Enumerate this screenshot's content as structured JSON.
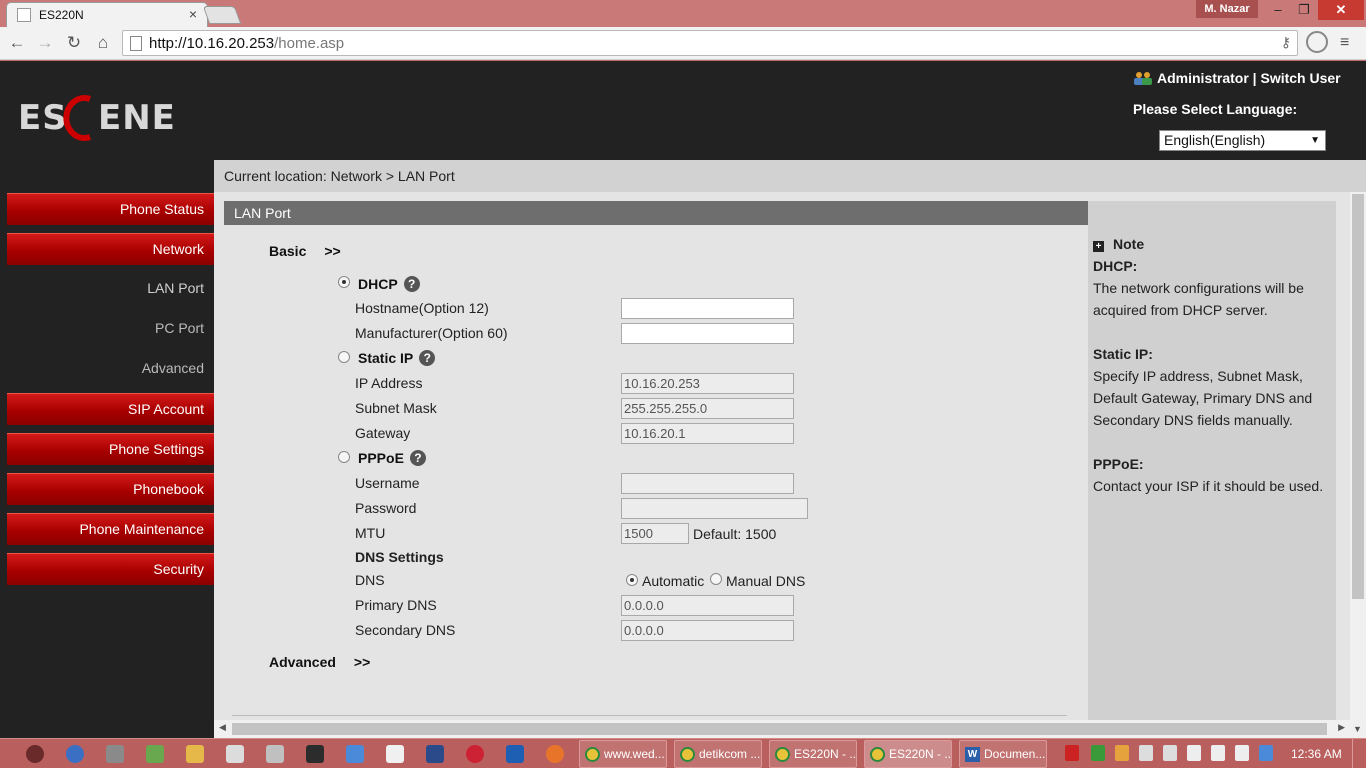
{
  "browser": {
    "tab_title": "ES220N",
    "tab_close": "×",
    "user_badge": "M. Nazar",
    "url_host": "http://10.16.20.253",
    "url_path": "/home.asp",
    "window_buttons": {
      "minimize": "–",
      "maximize": "❐",
      "close": "✕"
    },
    "nav_icons": {
      "back": "←",
      "forward": "→",
      "reload": "↻",
      "home": "⌂",
      "menu": "≡"
    }
  },
  "header": {
    "brand": "ESCENE",
    "admin": "Administrator | Switch User",
    "language_label": "Please Select Language:",
    "language_value": "English(English)"
  },
  "sidebar": {
    "items": [
      {
        "label": "Phone Status",
        "type": "main"
      },
      {
        "label": "Network",
        "type": "main"
      },
      {
        "label": "LAN Port",
        "type": "sub"
      },
      {
        "label": "PC Port",
        "type": "sub"
      },
      {
        "label": "Advanced",
        "type": "sub"
      },
      {
        "label": "SIP Account",
        "type": "main"
      },
      {
        "label": "Phone Settings",
        "type": "main"
      },
      {
        "label": "Phonebook",
        "type": "main"
      },
      {
        "label": "Phone Maintenance",
        "type": "main"
      },
      {
        "label": "Security",
        "type": "main"
      }
    ]
  },
  "main": {
    "breadcrumb": "Current location: Network > LAN Port",
    "panel_title": "LAN Port",
    "basic_label": "Basic",
    "basic_arrows": ">>",
    "advanced_label": "Advanced",
    "advanced_arrows": ">>",
    "dhcp": {
      "label": "DHCP",
      "selected": true,
      "hostname_label": "Hostname(Option 12)",
      "hostname_value": "",
      "manufacturer_label": "Manufacturer(Option 60)",
      "manufacturer_value": ""
    },
    "static_ip": {
      "label": "Static IP",
      "selected": false,
      "ip_label": "IP Address",
      "ip_value": "10.16.20.253",
      "mask_label": "Subnet Mask",
      "mask_value": "255.255.255.0",
      "gateway_label": "Gateway",
      "gateway_value": "10.16.20.1"
    },
    "pppoe": {
      "label": "PPPoE",
      "selected": false,
      "username_label": "Username",
      "username_value": "",
      "password_label": "Password",
      "password_value": "",
      "mtu_label": "MTU",
      "mtu_value": "1500",
      "mtu_default": "Default: 1500"
    },
    "dns": {
      "section_label": "DNS Settings",
      "dns_label": "DNS",
      "automatic": "Automatic",
      "manual": "Manual DNS",
      "mode": "Automatic",
      "primary_label": "Primary DNS",
      "primary_value": "0.0.0.0",
      "secondary_label": "Secondary DNS",
      "secondary_value": "0.0.0.0"
    },
    "help_glyph": "?"
  },
  "note": {
    "title": "Note",
    "dhcp_head": "DHCP:",
    "dhcp_text": "The network configurations will be acquired from DHCP server.",
    "static_head": "Static IP:",
    "static_text": "Specify IP address, Subnet Mask, Default Gateway, Primary DNS and Secondary DNS fields manually.",
    "pppoe_head": "PPPoE:",
    "pppoe_text": "Contact your ISP if it should be used."
  },
  "taskbar": {
    "tasks": [
      "www.wed...",
      "detikcom ...",
      "ES220N - ...",
      "ES220N - ...",
      "Documen..."
    ],
    "clock": "12:36 AM"
  },
  "colors": {
    "nav_red": "#b00000",
    "page_bg": "#222222",
    "content_bg": "#e4e4e4",
    "panel_head": "#6e6e6e",
    "titlebar": "#c97a78"
  }
}
